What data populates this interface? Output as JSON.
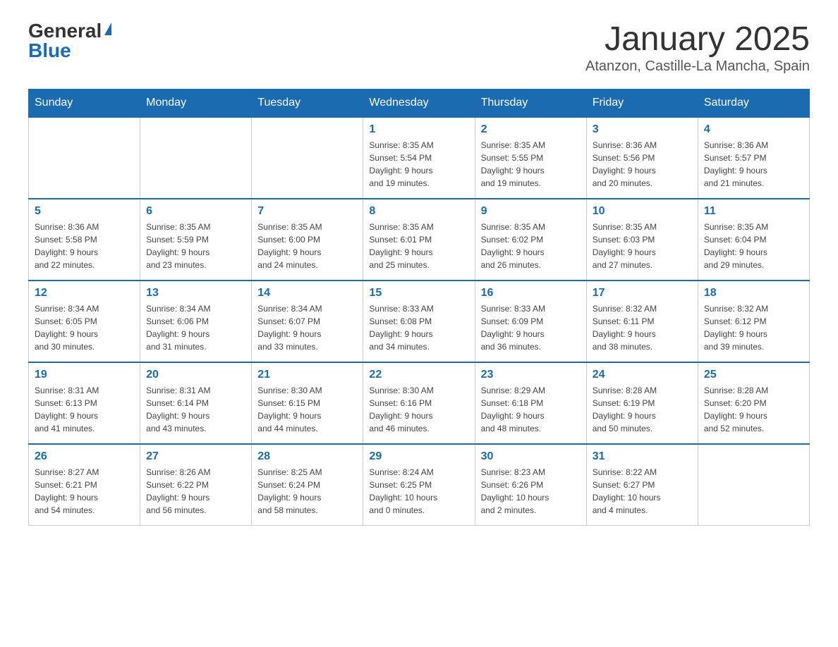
{
  "header": {
    "logo_general": "General",
    "logo_blue": "Blue",
    "month_title": "January 2025",
    "location": "Atanzon, Castille-La Mancha, Spain"
  },
  "days_of_week": [
    "Sunday",
    "Monday",
    "Tuesday",
    "Wednesday",
    "Thursday",
    "Friday",
    "Saturday"
  ],
  "weeks": [
    [
      {
        "day": "",
        "info": ""
      },
      {
        "day": "",
        "info": ""
      },
      {
        "day": "",
        "info": ""
      },
      {
        "day": "1",
        "info": "Sunrise: 8:35 AM\nSunset: 5:54 PM\nDaylight: 9 hours\nand 19 minutes."
      },
      {
        "day": "2",
        "info": "Sunrise: 8:35 AM\nSunset: 5:55 PM\nDaylight: 9 hours\nand 19 minutes."
      },
      {
        "day": "3",
        "info": "Sunrise: 8:36 AM\nSunset: 5:56 PM\nDaylight: 9 hours\nand 20 minutes."
      },
      {
        "day": "4",
        "info": "Sunrise: 8:36 AM\nSunset: 5:57 PM\nDaylight: 9 hours\nand 21 minutes."
      }
    ],
    [
      {
        "day": "5",
        "info": "Sunrise: 8:36 AM\nSunset: 5:58 PM\nDaylight: 9 hours\nand 22 minutes."
      },
      {
        "day": "6",
        "info": "Sunrise: 8:35 AM\nSunset: 5:59 PM\nDaylight: 9 hours\nand 23 minutes."
      },
      {
        "day": "7",
        "info": "Sunrise: 8:35 AM\nSunset: 6:00 PM\nDaylight: 9 hours\nand 24 minutes."
      },
      {
        "day": "8",
        "info": "Sunrise: 8:35 AM\nSunset: 6:01 PM\nDaylight: 9 hours\nand 25 minutes."
      },
      {
        "day": "9",
        "info": "Sunrise: 8:35 AM\nSunset: 6:02 PM\nDaylight: 9 hours\nand 26 minutes."
      },
      {
        "day": "10",
        "info": "Sunrise: 8:35 AM\nSunset: 6:03 PM\nDaylight: 9 hours\nand 27 minutes."
      },
      {
        "day": "11",
        "info": "Sunrise: 8:35 AM\nSunset: 6:04 PM\nDaylight: 9 hours\nand 29 minutes."
      }
    ],
    [
      {
        "day": "12",
        "info": "Sunrise: 8:34 AM\nSunset: 6:05 PM\nDaylight: 9 hours\nand 30 minutes."
      },
      {
        "day": "13",
        "info": "Sunrise: 8:34 AM\nSunset: 6:06 PM\nDaylight: 9 hours\nand 31 minutes."
      },
      {
        "day": "14",
        "info": "Sunrise: 8:34 AM\nSunset: 6:07 PM\nDaylight: 9 hours\nand 33 minutes."
      },
      {
        "day": "15",
        "info": "Sunrise: 8:33 AM\nSunset: 6:08 PM\nDaylight: 9 hours\nand 34 minutes."
      },
      {
        "day": "16",
        "info": "Sunrise: 8:33 AM\nSunset: 6:09 PM\nDaylight: 9 hours\nand 36 minutes."
      },
      {
        "day": "17",
        "info": "Sunrise: 8:32 AM\nSunset: 6:11 PM\nDaylight: 9 hours\nand 38 minutes."
      },
      {
        "day": "18",
        "info": "Sunrise: 8:32 AM\nSunset: 6:12 PM\nDaylight: 9 hours\nand 39 minutes."
      }
    ],
    [
      {
        "day": "19",
        "info": "Sunrise: 8:31 AM\nSunset: 6:13 PM\nDaylight: 9 hours\nand 41 minutes."
      },
      {
        "day": "20",
        "info": "Sunrise: 8:31 AM\nSunset: 6:14 PM\nDaylight: 9 hours\nand 43 minutes."
      },
      {
        "day": "21",
        "info": "Sunrise: 8:30 AM\nSunset: 6:15 PM\nDaylight: 9 hours\nand 44 minutes."
      },
      {
        "day": "22",
        "info": "Sunrise: 8:30 AM\nSunset: 6:16 PM\nDaylight: 9 hours\nand 46 minutes."
      },
      {
        "day": "23",
        "info": "Sunrise: 8:29 AM\nSunset: 6:18 PM\nDaylight: 9 hours\nand 48 minutes."
      },
      {
        "day": "24",
        "info": "Sunrise: 8:28 AM\nSunset: 6:19 PM\nDaylight: 9 hours\nand 50 minutes."
      },
      {
        "day": "25",
        "info": "Sunrise: 8:28 AM\nSunset: 6:20 PM\nDaylight: 9 hours\nand 52 minutes."
      }
    ],
    [
      {
        "day": "26",
        "info": "Sunrise: 8:27 AM\nSunset: 6:21 PM\nDaylight: 9 hours\nand 54 minutes."
      },
      {
        "day": "27",
        "info": "Sunrise: 8:26 AM\nSunset: 6:22 PM\nDaylight: 9 hours\nand 56 minutes."
      },
      {
        "day": "28",
        "info": "Sunrise: 8:25 AM\nSunset: 6:24 PM\nDaylight: 9 hours\nand 58 minutes."
      },
      {
        "day": "29",
        "info": "Sunrise: 8:24 AM\nSunset: 6:25 PM\nDaylight: 10 hours\nand 0 minutes."
      },
      {
        "day": "30",
        "info": "Sunrise: 8:23 AM\nSunset: 6:26 PM\nDaylight: 10 hours\nand 2 minutes."
      },
      {
        "day": "31",
        "info": "Sunrise: 8:22 AM\nSunset: 6:27 PM\nDaylight: 10 hours\nand 4 minutes."
      },
      {
        "day": "",
        "info": ""
      }
    ]
  ]
}
